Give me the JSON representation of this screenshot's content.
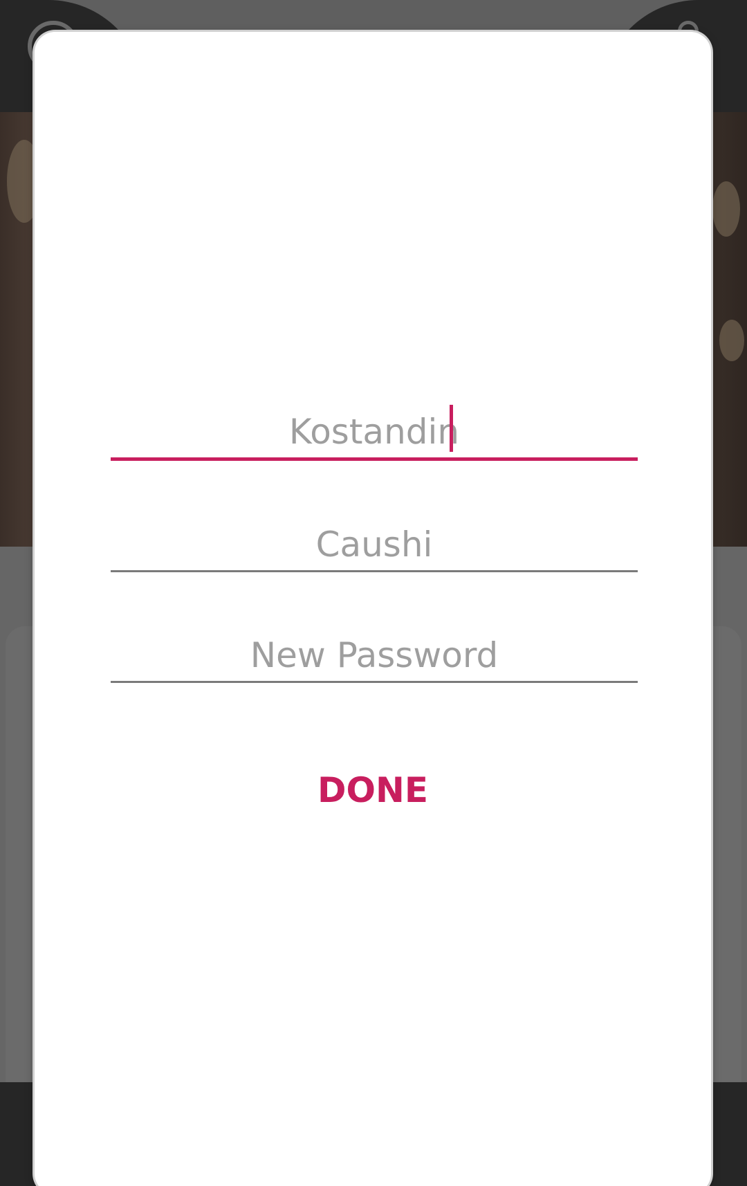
{
  "form": {
    "first_name_value": "Kostandin",
    "last_name_value": "Caushi",
    "password_placeholder": "New Password",
    "done_label": "DONE"
  },
  "colors": {
    "accent": "#c81e5e",
    "hint_text": "#9e9e9e",
    "scrim": "#666666"
  },
  "icons": {
    "top_left": "search-icon",
    "top_right": "profile-icon"
  }
}
